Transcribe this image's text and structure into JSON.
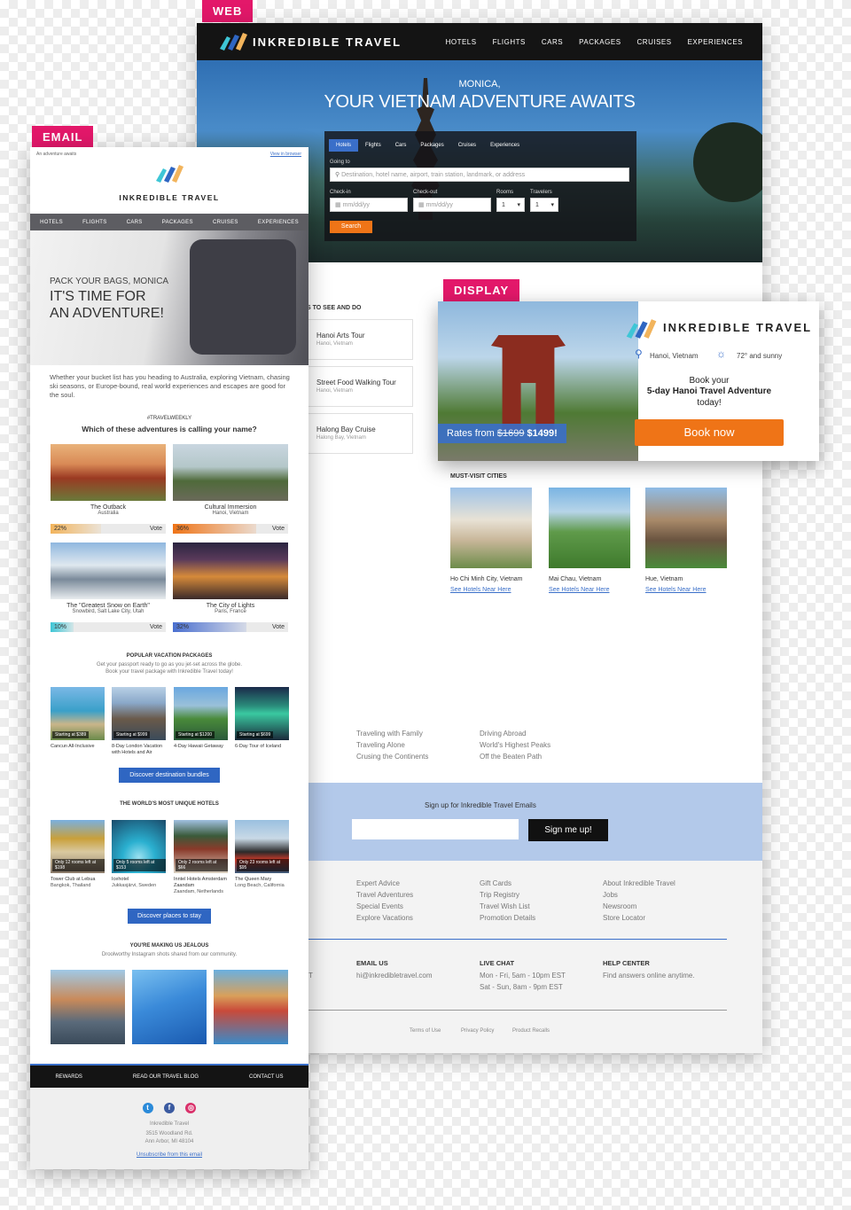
{
  "web": {
    "tag": "WEB",
    "brand": "INKREDIBLE TRAVEL",
    "nav": [
      "HOTELS",
      "FLIGHTS",
      "CARS",
      "PACKAGES",
      "CRUISES",
      "EXPERIENCES"
    ],
    "hero": {
      "greeting": "MONICA,",
      "title": "YOUR VIETNAM ADVENTURE AWAITS"
    },
    "search": {
      "tabs": [
        "Hotels",
        "Flights",
        "Cars",
        "Packages",
        "Cruises",
        "Experiences"
      ],
      "going_to_label": "Going to",
      "going_to_placeholder": "Destination, hotel name, airport, train station, landmark, or address",
      "checkin_label": "Check-in",
      "checkin_placeholder": "mm/dd/yy",
      "checkout_label": "Check-out",
      "checkout_placeholder": "mm/dd/yy",
      "rooms_label": "Rooms",
      "rooms_value": "1",
      "travelers_label": "Travelers",
      "travelers_value": "1",
      "search_button": "Search"
    },
    "things_heading": "S TO SEE AND DO",
    "things": [
      {
        "title": "Hanoi Arts Tour",
        "sub": "Hanoi, Vietnam"
      },
      {
        "title": "Street Food Walking Tour",
        "sub": "Hanoi, Vietnam"
      },
      {
        "title": "Halong Bay Cruise",
        "sub": "Halong Bay, Vietnam"
      }
    ],
    "cities_heading": "MUST-VISIT CITIES",
    "cities": [
      {
        "name": "Ho Chi Minh City, Vietnam",
        "link": "See Hotels Near Here"
      },
      {
        "name": "Mai Chau, Vietnam",
        "link": "See Hotels Near Here"
      },
      {
        "name": "Hue, Vietnam",
        "link": "See Hotels Near Here"
      }
    ],
    "article_links": [
      [
        "Traveling with Family",
        "Traveling Alone",
        "Crusing the Continents"
      ],
      [
        "Driving Abroad",
        "World's Highest Peaks",
        "Off the Beaten Path"
      ]
    ],
    "signup": {
      "label": "Sign up for Inkredible Travel Emails",
      "button": "Sign me up!"
    },
    "footer_links": [
      [
        "Expert Advice",
        "Travel Adventures",
        "Special Events",
        "Explore Vacations"
      ],
      [
        "Gift Cards",
        "Trip Registry",
        "Travel Wish List",
        "Promotion Details"
      ],
      [
        "About Inkredible Travel",
        "Jobs",
        "Newsroom",
        "Store Locator"
      ]
    ],
    "contact": [
      {
        "head": "EMAIL US",
        "lines": [
          "hi@inkredibletravel.com"
        ]
      },
      {
        "head": "LIVE CHAT",
        "lines": [
          "Mon - Fri, 5am - 10pm EST",
          "Sat - Sun, 8am - 9pm EST"
        ]
      },
      {
        "head": "HELP CENTER",
        "lines": [
          "Find answers online anytime."
        ]
      }
    ],
    "partial_letter": "T",
    "legal": [
      "Terms of Use",
      "Privacy Policy",
      "Product Recalls"
    ]
  },
  "display": {
    "tag": "DISPLAY",
    "brand": "INKREDIBLE TRAVEL",
    "location": "Hanoi, Vietnam",
    "weather": "72° and sunny",
    "line1": "Book your",
    "line2": "5-day Hanoi Travel Adventure",
    "line3": "today!",
    "rates_prefix": "Rates from",
    "old_price": "$1699",
    "new_price": "$1499!",
    "button": "Book now"
  },
  "email": {
    "tag": "EMAIL",
    "preheader": "An adventure awaits",
    "view_browser": "View in browser",
    "brand": "INKREDIBLE TRAVEL",
    "nav": [
      "HOTELS",
      "FLIGHTS",
      "CARS",
      "PACKAGES",
      "CRUISES",
      "EXPERIENCES"
    ],
    "hero": {
      "line1": "PACK YOUR BAGS, MONICA",
      "line2": "IT'S TIME FOR",
      "line3": "AN ADVENTURE!"
    },
    "intro": "Whether your bucket list has you heading to Australia, exploring Vietnam, chasing ski seasons, or Europe-bound, real world experiences and escapes are good for the soul.",
    "hashtag": "#TRAVELWEEKLY",
    "question": "Which of these adventures is calling your name?",
    "adventures": [
      {
        "title": "The Outback",
        "sub": "Australia",
        "pct": "22%",
        "value": 22,
        "vote": "Vote",
        "color": "#f2b45c"
      },
      {
        "title": "Cultural Immersion",
        "sub": "Hanoi, Vietnam",
        "pct": "36%",
        "value": 36,
        "vote": "Vote",
        "color": "#ef7417"
      },
      {
        "title": "The \"Greatest Snow on Earth\"",
        "sub": "Snowbird, Salt Lake City, Utah",
        "pct": "10%",
        "value": 10,
        "vote": "Vote",
        "color": "#3ec6d6"
      },
      {
        "title": "The City of Lights",
        "sub": "Paris, France",
        "pct": "32%",
        "value": 32,
        "vote": "Vote",
        "color": "#4a6fd0"
      }
    ],
    "packages_heading": "POPULAR VACATION PACKAGES",
    "packages_sub1": "Get your passport ready to go as you jet-set across the globe.",
    "packages_sub2": "Book your travel package with Inkredible Travel today!",
    "packages": [
      {
        "price": "Starting at $389",
        "title": "Cancun All-Inclusive"
      },
      {
        "price": "Starting at $999",
        "title": "8-Day London Vacation with Hotels and Air"
      },
      {
        "price": "Starting at $1200",
        "title": "4-Day Hawaii Getaway"
      },
      {
        "price": "Starting at $699",
        "title": "6-Day Tour of Iceland"
      }
    ],
    "packages_button": "Discover destination bundles",
    "hotels_heading": "THE WORLD'S MOST UNIQUE HOTELS",
    "hotels": [
      {
        "price": "Only 12 rooms left at $198",
        "title": "Tower Club at Lebua",
        "sub": "Bangkok, Thailand"
      },
      {
        "price": "Only 5 rooms left at $153",
        "title": "Icehotel",
        "sub": "Jukkasjärvi, Sweden"
      },
      {
        "price": "Only 2 rooms left at $66",
        "title": "Inntel Hotels Amsterdam Zaandam",
        "sub": "Zaandam, Netherlands"
      },
      {
        "price": "Only 23 rooms left at $95",
        "title": "The Queen Mary",
        "sub": "Long Beach, California"
      }
    ],
    "hotels_button": "Discover places to stay",
    "insta_heading": "YOU'RE MAKING US JEALOUS",
    "insta_sub": "Droolworthy Instagram shots shared from our community.",
    "footer_nav": [
      "REWARDS",
      "READ OUR TRAVEL BLOG",
      "CONTACT US"
    ],
    "company": "Inkredible Travel",
    "address1": "3515 Woodland Rd.",
    "address2": "Ann Arbor, MI 48104",
    "unsubscribe": "Unsubscribe from this email"
  }
}
